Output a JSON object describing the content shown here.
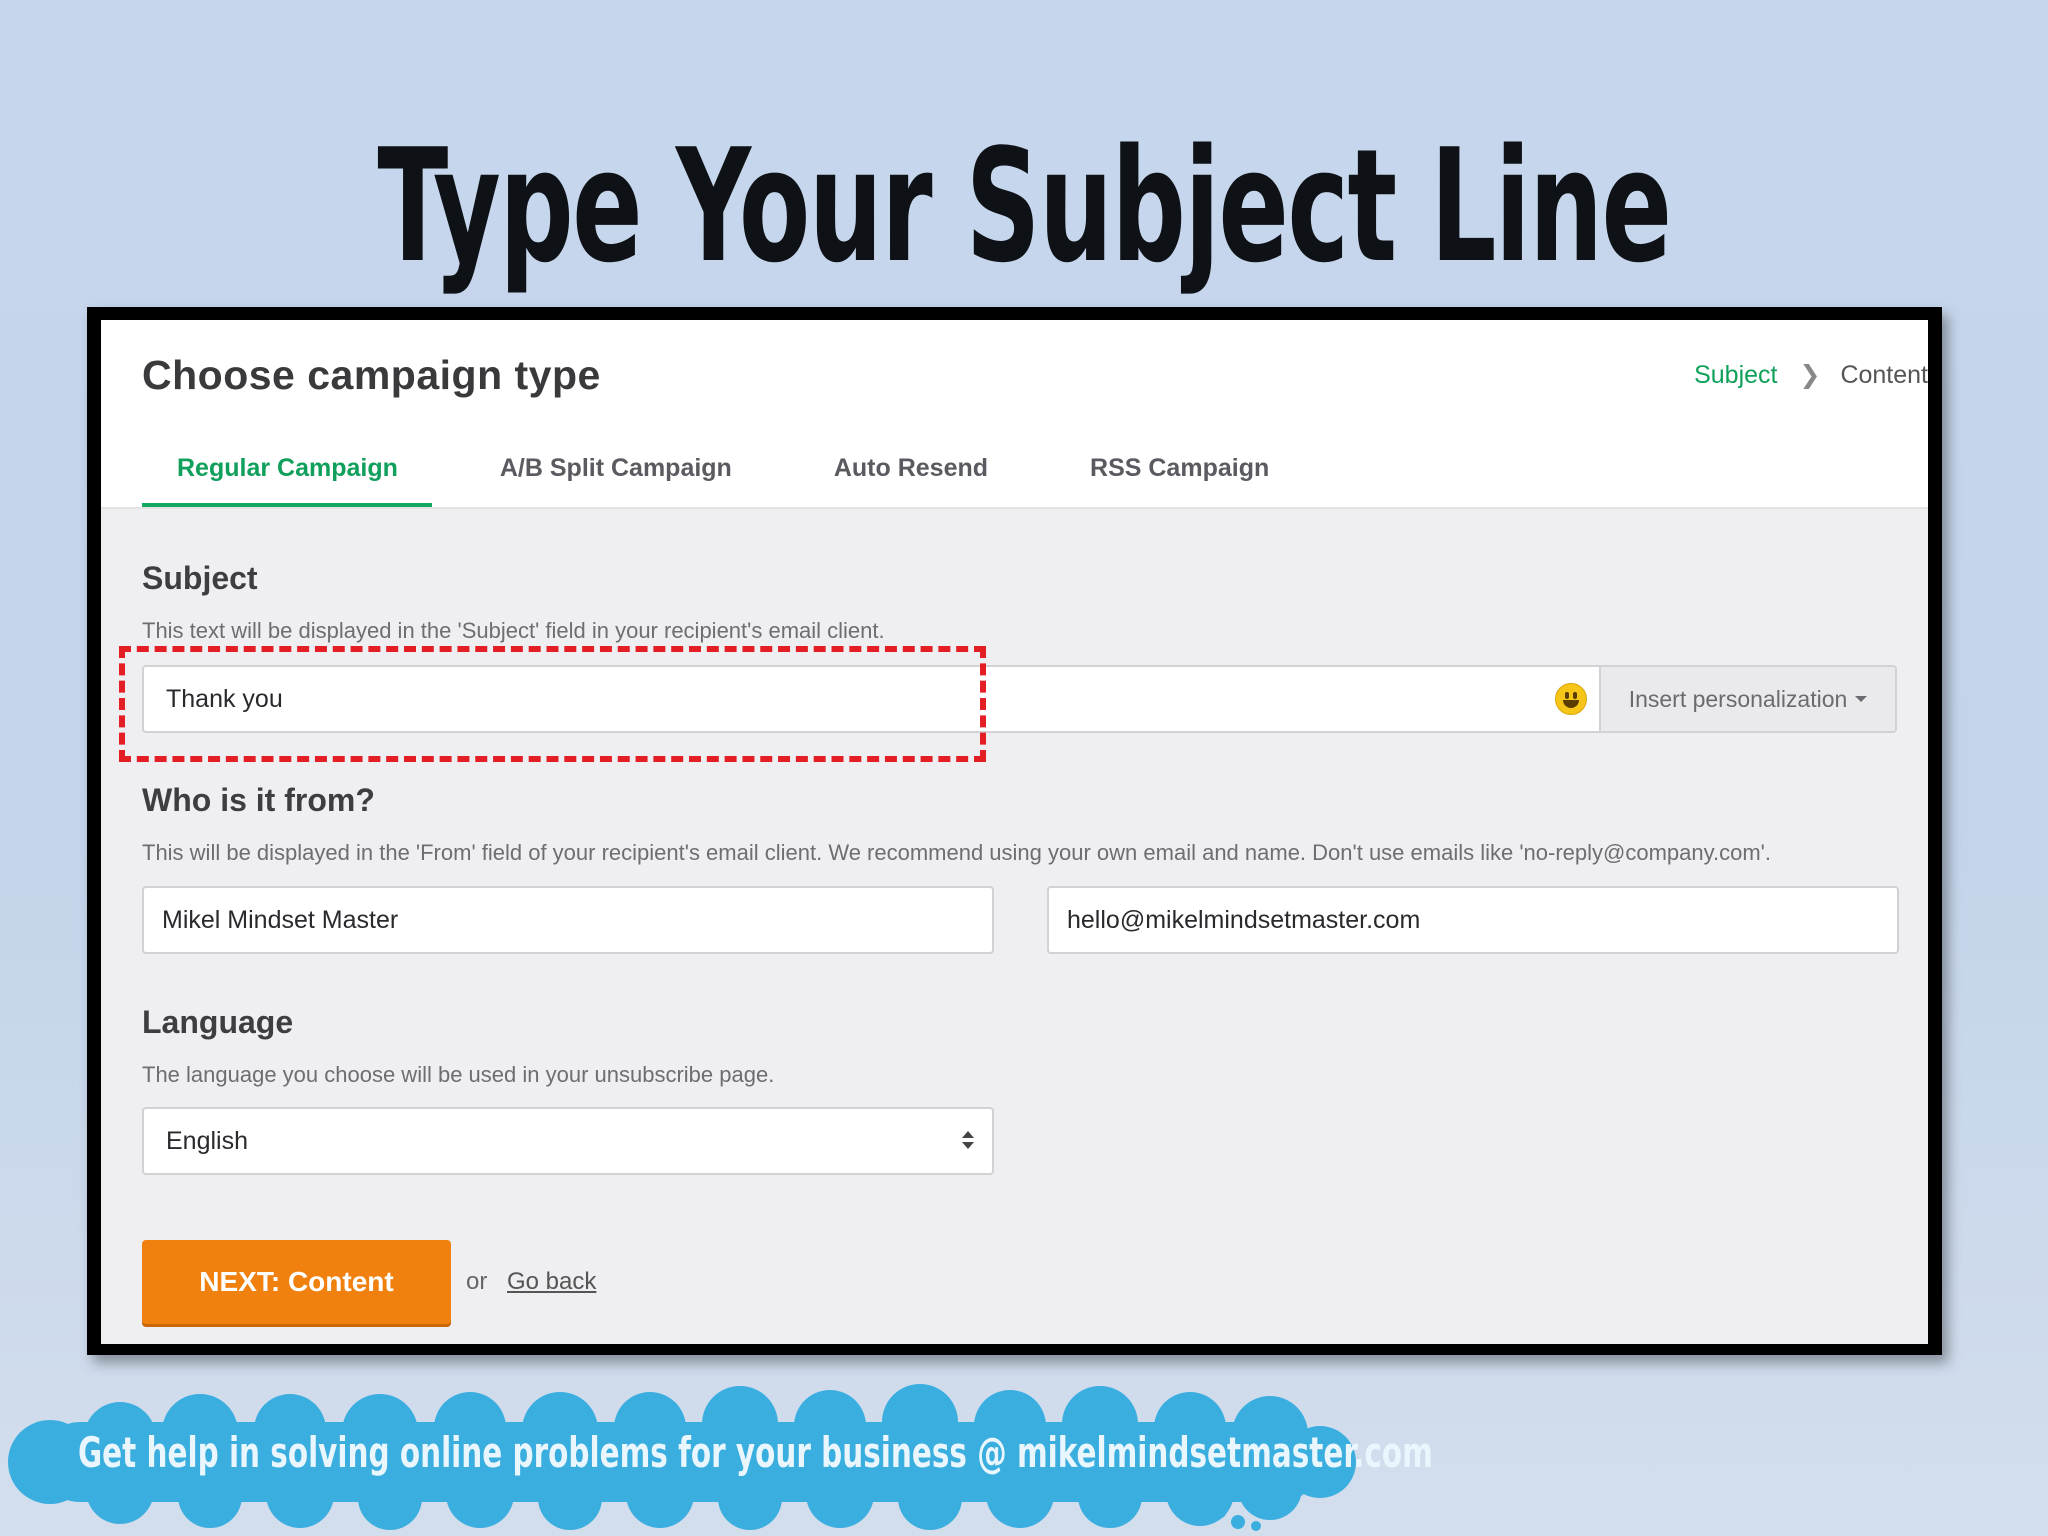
{
  "slide": {
    "title": "Type Your Subject Line",
    "banner_text": "Get help in solving online problems for your business @ mikelmindsetmaster.com"
  },
  "app": {
    "heading": "Choose campaign type",
    "steps": [
      "Subject",
      "Content"
    ],
    "tabs": [
      {
        "label": "Regular Campaign",
        "active": true
      },
      {
        "label": "A/B Split Campaign",
        "active": false
      },
      {
        "label": "Auto Resend",
        "active": false
      },
      {
        "label": "RSS Campaign",
        "active": false
      }
    ],
    "subject": {
      "title": "Subject",
      "description": "This text will be displayed in the 'Subject' field in your recipient's email client.",
      "value": "Thank you",
      "personalize_label": "Insert personalization",
      "emoji_icon": "smiley-icon"
    },
    "from": {
      "title": "Who is it from?",
      "description": "This will be displayed in the 'From' field of your recipient's email client. We recommend using your own email and name. Don't use emails like 'no-reply@company.com'.",
      "name_value": "Mikel Mindset Master",
      "email_value": "hello@mikelmindsetmaster.com"
    },
    "language": {
      "title": "Language",
      "description": "The language you choose will be used in your unsubscribe page.",
      "selected": "English"
    },
    "actions": {
      "next_label": "NEXT: Content",
      "or_text": "or",
      "back_label": "Go back"
    }
  },
  "colors": {
    "accent_green": "#13a860",
    "next_orange": "#f0810f",
    "highlight_red": "#e41e25",
    "banner_blue": "#3aaedf"
  }
}
